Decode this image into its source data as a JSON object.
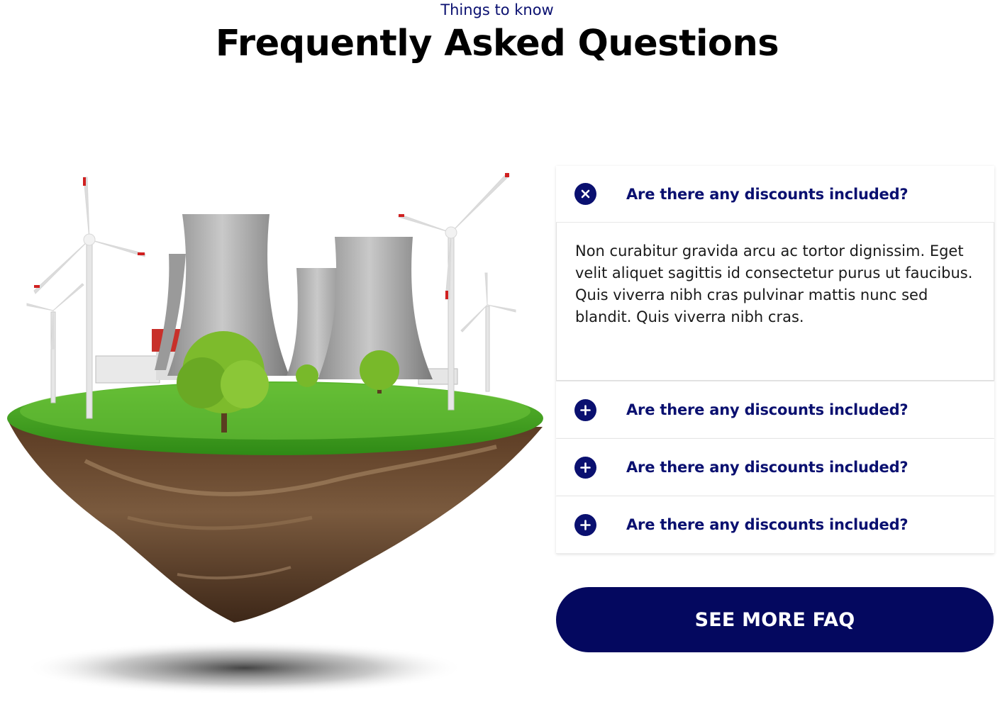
{
  "header": {
    "eyebrow": "Things to know",
    "title": "Frequently Asked Questions"
  },
  "illustration": {
    "alt": "Floating island with cooling towers and wind turbines"
  },
  "faq": {
    "items": [
      {
        "question": "Are there any discounts included?",
        "answer": "Non curabitur gravida arcu ac tortor dignissim. Eget velit aliquet sagittis id consectetur purus ut faucibus. Quis viverra nibh cras pulvinar mattis nunc sed blandit. Quis viverra nibh cras.",
        "expanded": true,
        "icon": "close-icon"
      },
      {
        "question": "Are there any discounts included?",
        "expanded": false,
        "icon": "plus-icon"
      },
      {
        "question": "Are there any discounts included?",
        "expanded": false,
        "icon": "plus-icon"
      },
      {
        "question": "Are there any discounts included?",
        "expanded": false,
        "icon": "plus-icon"
      }
    ]
  },
  "cta": {
    "label": "SEE MORE FAQ"
  },
  "colors": {
    "accent": "#0a1070",
    "button": "#04085f"
  }
}
